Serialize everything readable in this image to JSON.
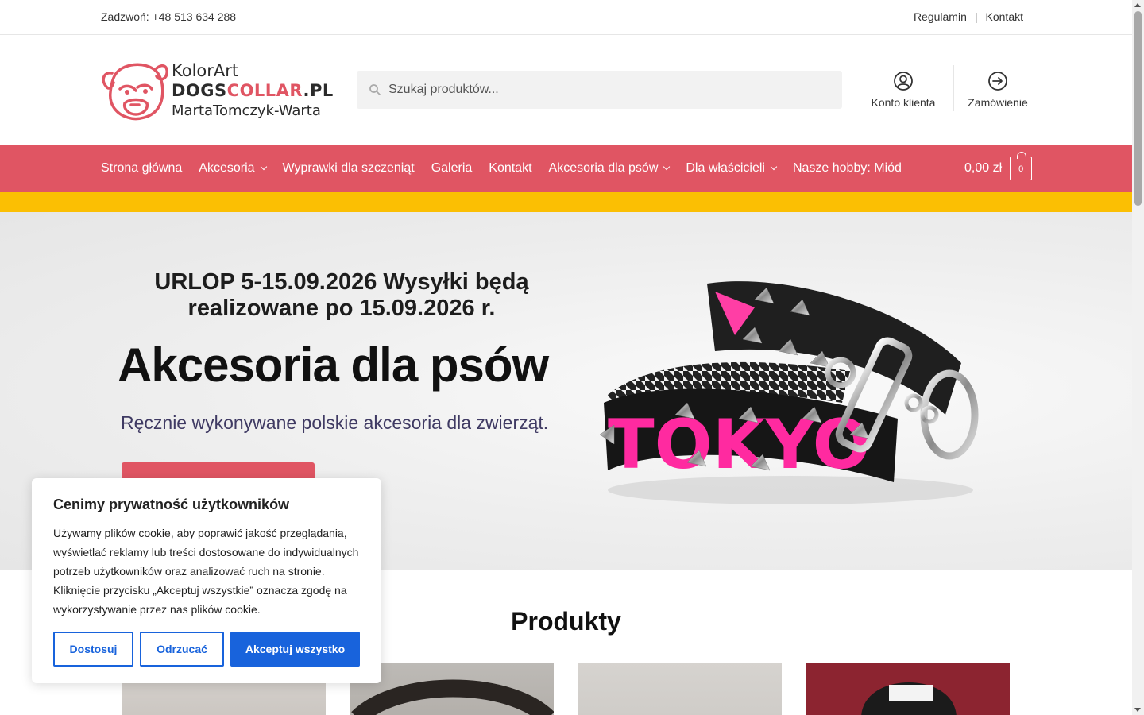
{
  "topbar": {
    "phone": "Zadzwoń: +48 513 634 288",
    "links": [
      "Regulamin",
      "Kontakt"
    ],
    "separator": "|"
  },
  "logo": {
    "line1": "KolorArt",
    "line2_a": "DOGS",
    "line2_b": "COLLAR",
    "line2_c": ".PL",
    "line3": "MartaTomczyk-Warta"
  },
  "search": {
    "placeholder": "Szukaj produktów..."
  },
  "header_buttons": {
    "account": "Konto klienta",
    "order": "Zamówienie"
  },
  "nav": {
    "items": [
      {
        "label": "Strona główna",
        "dropdown": false
      },
      {
        "label": "Akcesoria",
        "dropdown": true
      },
      {
        "label": "Wyprawki dla szczeniąt",
        "dropdown": false
      },
      {
        "label": "Galeria",
        "dropdown": false
      },
      {
        "label": "Kontakt",
        "dropdown": false
      },
      {
        "label": "Akcesoria dla psów",
        "dropdown": true
      },
      {
        "label": "Dla właścicieli",
        "dropdown": true
      },
      {
        "label": "Nasze hobby: Miód",
        "dropdown": false
      }
    ],
    "cart_total": "0,00 zł",
    "cart_count": "0"
  },
  "hero": {
    "notice": "URLOP 5-15.09.2026 Wysyłki będą realizowane po 15.09.2026 r.",
    "title": "Akcesoria dla psów",
    "subtitle": "Ręcznie wykonywane polskie akcesoria dla zwierząt.",
    "image_text": "TOKYO"
  },
  "products": {
    "title": "Produkty"
  },
  "cookie": {
    "title": "Cenimy prywatność użytkowników",
    "body": "Używamy plików cookie, aby poprawić jakość przeglądania, wyświetlać reklamy lub treści dostosowane do indywidualnych potrzeb użytkowników oraz analizować ruch na stronie. Kliknięcie przycisku „Akceptuj wszystkie” oznacza zgodę na wykorzystywanie przez nas plików cookie.",
    "customize": "Dostosuj",
    "reject": "Odrzucać",
    "accept": "Akceptuj wszystko"
  },
  "colors": {
    "brand_red": "#e05563",
    "accent_yellow": "#fbbf03",
    "cookie_blue": "#1863dc"
  }
}
